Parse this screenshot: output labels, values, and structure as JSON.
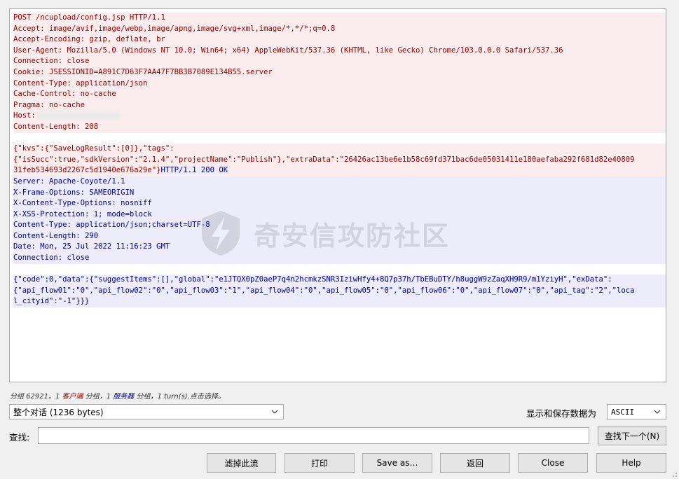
{
  "stream": {
    "lines": [
      {
        "text": "POST /ncupload/config.jsp HTTP/1.1",
        "dir": "req"
      },
      {
        "text": "Accept: image/avif,image/webp,image/apng,image/svg+xml,image/*,*/*;q=0.8",
        "dir": "req"
      },
      {
        "text": "Accept-Encoding: gzip, deflate, br",
        "dir": "req"
      },
      {
        "text": "User-Agent: Mozilla/5.0 (Windows NT 10.0; Win64; x64) AppleWebKit/537.36 (KHTML, like Gecko) Chrome/103.0.0.0 Safari/537.36",
        "dir": "req"
      },
      {
        "text": "Connection: close",
        "dir": "req"
      },
      {
        "text": "Cookie: JSESSIONID=A891C7D63F7AA47F7BB3B7089E134B55.server",
        "dir": "req"
      },
      {
        "text": "Content-Type: application/json",
        "dir": "req"
      },
      {
        "text": "Cache-Control: no-cache",
        "dir": "req"
      },
      {
        "text": "Pragma: no-cache",
        "dir": "req"
      },
      {
        "text": "Host:",
        "dir": "req",
        "redacted": true
      },
      {
        "text": "Content-Length: 208",
        "dir": "req"
      },
      {
        "text": "",
        "dir": "none"
      },
      {
        "text": "{\"kvs\":{\"SaveLogResult\":[0]},\"tags\":",
        "dir": "req"
      },
      {
        "text": "{\"isSucc\":true,\"sdkVersion\":\"2.1.4\",\"projectName\":\"Publish\"},\"extraData\":\"26426ac13be6e1b58c69fd371bac6de05031411e180aefaba292f681d82e40809",
        "dir": "req"
      },
      {
        "text": "31feb534693d2267c5d1940e676a29e\"}",
        "dir": "req",
        "tail": "HTTP/1.1 200 OK"
      },
      {
        "text": "Server: Apache-Coyote/1.1",
        "dir": "resp"
      },
      {
        "text": "X-Frame-Options: SAMEORIGIN",
        "dir": "resp"
      },
      {
        "text": "X-Content-Type-Options: nosniff",
        "dir": "resp"
      },
      {
        "text": "X-XSS-Protection: 1; mode=block",
        "dir": "resp"
      },
      {
        "text": "Content-Type: application/json;charset=UTF-8",
        "dir": "resp"
      },
      {
        "text": "Content-Length: 290",
        "dir": "resp"
      },
      {
        "text": "Date: Mon, 25 Jul 2022 11:16:23 GMT",
        "dir": "resp"
      },
      {
        "text": "Connection: close",
        "dir": "resp"
      },
      {
        "text": "",
        "dir": "none"
      },
      {
        "text": "{\"code\":0,\"data\":{\"suggestItems\":[],\"global\":\"e1JTQX0pZ0aeP7q4n2hcmkzSNR3IziwHfy4+8Q7p37h/TbEBuDTY/h8uggW9zZaqXH9R9/m1YziyH\",\"exData\":",
        "dir": "resp"
      },
      {
        "text": "{\"api_flow01\":\"0\",\"api_flow02\":\"0\",\"api_flow03\":\"1\",\"api_flow04\":\"0\",\"api_flow05\":\"0\",\"api_flow06\":\"0\",\"api_flow07\":\"0\",\"api_tag\":\"2\",\"loca",
        "dir": "resp"
      },
      {
        "text": "l_cityid\":\"-1\"}}}",
        "dir": "resp"
      }
    ]
  },
  "watermark": {
    "text": "奇安信攻防社区"
  },
  "status": {
    "prefix": "分组 62921。1 ",
    "client": "客户端",
    "mid": " 分组，1 ",
    "server": "服务器",
    "suffix": " 分组，1 turn(s).点击选择。"
  },
  "conversation_select": {
    "value": "整个对话 (1236 bytes)"
  },
  "display_label": "显示和保存数据为",
  "format_select": {
    "value": "ASCII"
  },
  "find": {
    "label": "查找:",
    "value": "",
    "next_button": "查找下一个(N)"
  },
  "buttons": {
    "filter": "滤掉此流",
    "print": "打印",
    "save_as": "Save as…",
    "back": "返回",
    "close": "Close",
    "help": "Help"
  },
  "colors": {
    "client": "#8b0000",
    "server": "#000080",
    "client_bg": "#fbeded",
    "server_bg": "#ececfb"
  }
}
